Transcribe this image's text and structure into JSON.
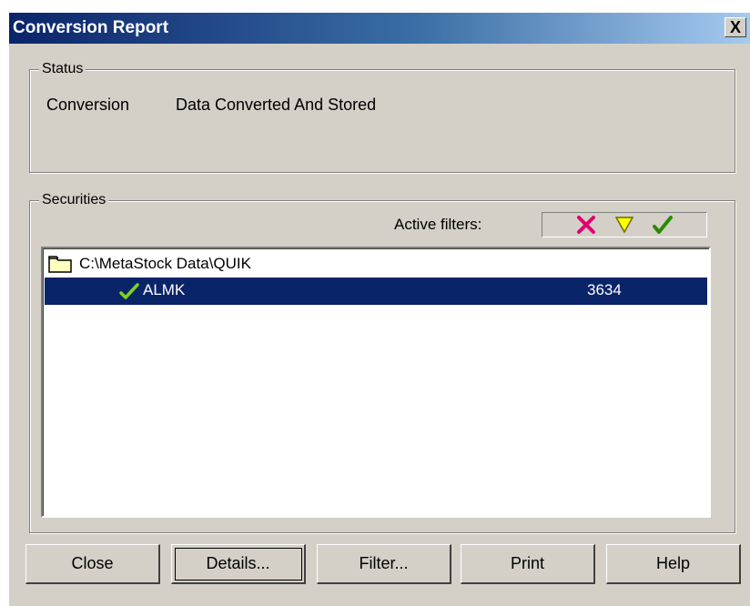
{
  "window": {
    "title": "Conversion Report",
    "close_glyph": "X"
  },
  "status": {
    "legend": "Status",
    "label": "Conversion",
    "value": "Data Converted And Stored"
  },
  "securities": {
    "legend": "Securities",
    "active_filters_label": "Active filters:",
    "filter_icons": [
      "red-x-icon",
      "yellow-triangle-icon",
      "green-check-icon"
    ],
    "tree": {
      "root_label": "C:\\MetaStock Data\\QUIK",
      "root_icon": "folder-icon",
      "items": [
        {
          "icon": "green-check-icon",
          "name": "ALMK",
          "count": "3634",
          "selected": true
        }
      ]
    }
  },
  "buttons": {
    "close": "Close",
    "details": "Details...",
    "filter": "Filter...",
    "print": "Print",
    "help": "Help"
  },
  "colors": {
    "dialog_bg": "#d4d0c8",
    "title_gradient_start": "#0a246a",
    "selection_bg": "#0a246a",
    "filter_x": "#e0006e",
    "filter_triangle": "#ffff00",
    "filter_check": "#2a8a00"
  }
}
